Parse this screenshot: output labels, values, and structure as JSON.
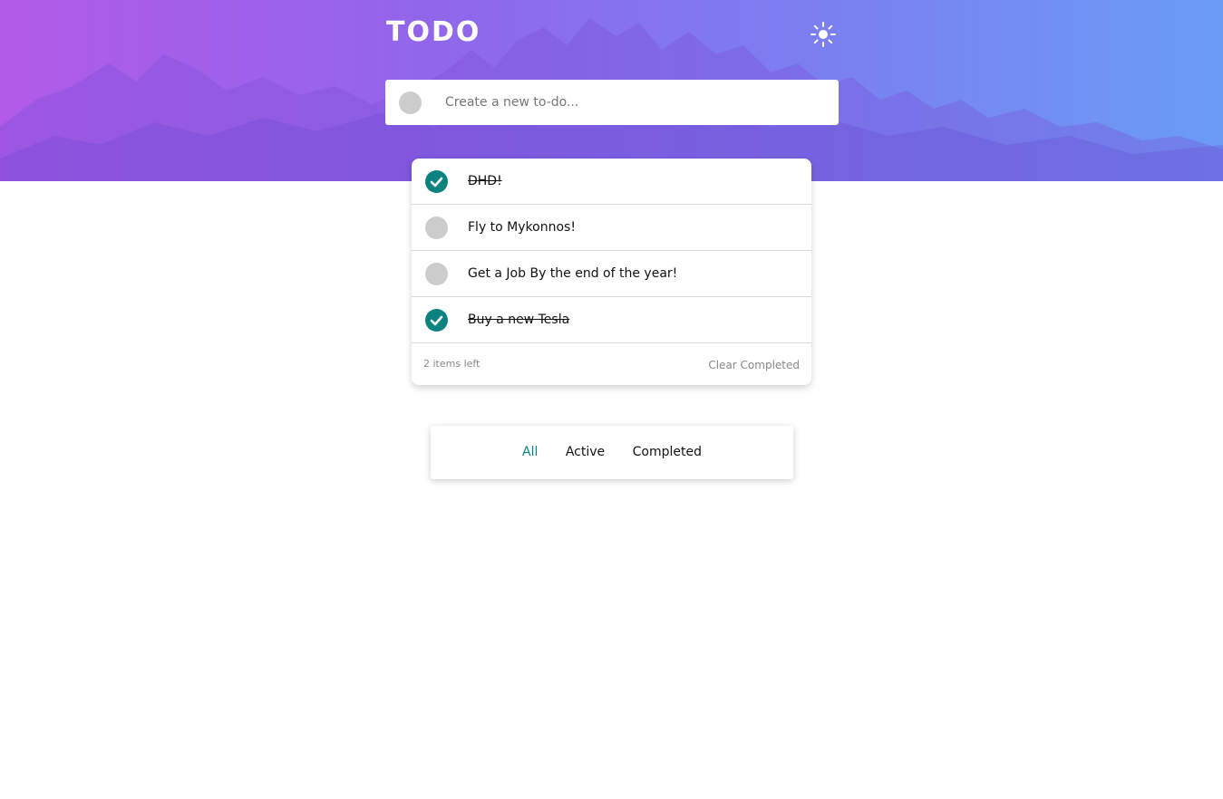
{
  "app": {
    "title": "TODO",
    "theme_icon": "sun-icon"
  },
  "new_todo": {
    "placeholder": "Create a new to-do..."
  },
  "todos": [
    {
      "text": "DHD!",
      "completed": true
    },
    {
      "text": "Fly to Mykonnos!",
      "completed": false
    },
    {
      "text": "Get a Job By the end of the year!",
      "completed": false
    },
    {
      "text": "Buy a new Tesla",
      "completed": true
    }
  ],
  "footer": {
    "items_left": "2 items left",
    "clear_label": "Clear Completed"
  },
  "filters": {
    "all": "All",
    "active": "Active",
    "completed": "Completed",
    "selected": "All"
  },
  "colors": {
    "accent": "#0a8380",
    "gradient_start": "#b15ae8",
    "gradient_end": "#6a9cf6",
    "unchecked": "#cccccc"
  }
}
